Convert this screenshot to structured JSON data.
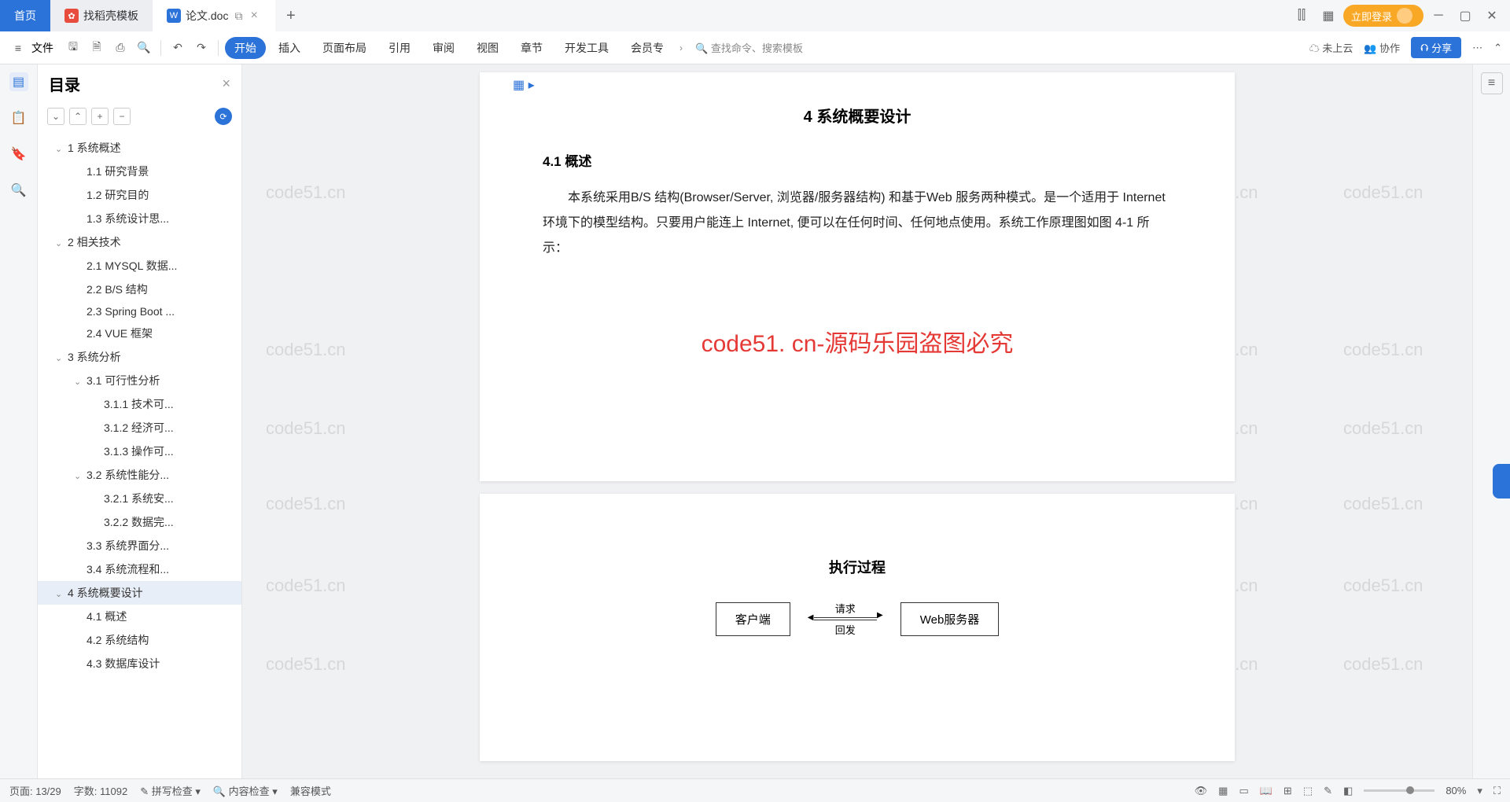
{
  "titlebar": {
    "tabs": [
      {
        "label": "首页"
      },
      {
        "label": "找稻壳模板"
      },
      {
        "label": "论文.doc"
      }
    ],
    "login": "立即登录"
  },
  "toolbar": {
    "file": "文件",
    "menus": [
      "开始",
      "插入",
      "页面布局",
      "引用",
      "审阅",
      "视图",
      "章节",
      "开发工具",
      "会员专"
    ],
    "search": "查找命令、搜索模板",
    "cloud": "未上云",
    "collab": "协作",
    "share": "分享"
  },
  "outline": {
    "title": "目录",
    "items": [
      {
        "level": 1,
        "label": "1 系统概述",
        "chev": true
      },
      {
        "level": 2,
        "label": "1.1 研究背景"
      },
      {
        "level": 2,
        "label": "1.2 研究目的"
      },
      {
        "level": 2,
        "label": "1.3 系统设计思..."
      },
      {
        "level": 1,
        "label": "2 相关技术",
        "chev": true
      },
      {
        "level": 2,
        "label": "2.1 MYSQL 数据..."
      },
      {
        "level": 2,
        "label": "2.2 B/S 结构"
      },
      {
        "level": 2,
        "label": "2.3 Spring Boot ..."
      },
      {
        "level": 2,
        "label": "2.4 VUE 框架"
      },
      {
        "level": 1,
        "label": "3 系统分析",
        "chev": true
      },
      {
        "level": 2,
        "label": "3.1 可行性分析",
        "chev": true
      },
      {
        "level": 3,
        "label": "3.1.1 技术可..."
      },
      {
        "level": 3,
        "label": "3.1.2 经济可..."
      },
      {
        "level": 3,
        "label": "3.1.3 操作可..."
      },
      {
        "level": 2,
        "label": "3.2 系统性能分...",
        "chev": true
      },
      {
        "level": 3,
        "label": "3.2.1 系统安..."
      },
      {
        "level": 3,
        "label": "3.2.2 数据完..."
      },
      {
        "level": 2,
        "label": "3.3 系统界面分..."
      },
      {
        "level": 2,
        "label": "3.4 系统流程和..."
      },
      {
        "level": 1,
        "label": "4 系统概要设计",
        "chev": true,
        "selected": true
      },
      {
        "level": 2,
        "label": "4.1 概述"
      },
      {
        "level": 2,
        "label": "4.2 系统结构"
      },
      {
        "level": 2,
        "label": "4.3 数据库设计"
      }
    ]
  },
  "document": {
    "chapter_title": "4 系统概要设计",
    "section_41": "4.1 概述",
    "paragraph": "本系统采用B/S 结构(Browser/Server, 浏览器/服务器结构) 和基于Web 服务两种模式。是一个适用于 Internet 环境下的模型结构。只要用户能连上 Internet, 便可以在任何时间、任何地点使用。系统工作原理图如图 4-1 所示：",
    "watermark_red": "code51. cn-源码乐园盗图必究",
    "page2_heading": "执行过程",
    "diagram": {
      "client": "客户端",
      "server": "Web服务器",
      "req": "请求",
      "res": "回发"
    },
    "gray_wm": "code51.cn"
  },
  "status": {
    "page": "页面: 13/29",
    "words": "字数: 11092",
    "spell": "拼写检查",
    "content": "内容检查",
    "compat": "兼容模式",
    "zoom": "80%"
  }
}
